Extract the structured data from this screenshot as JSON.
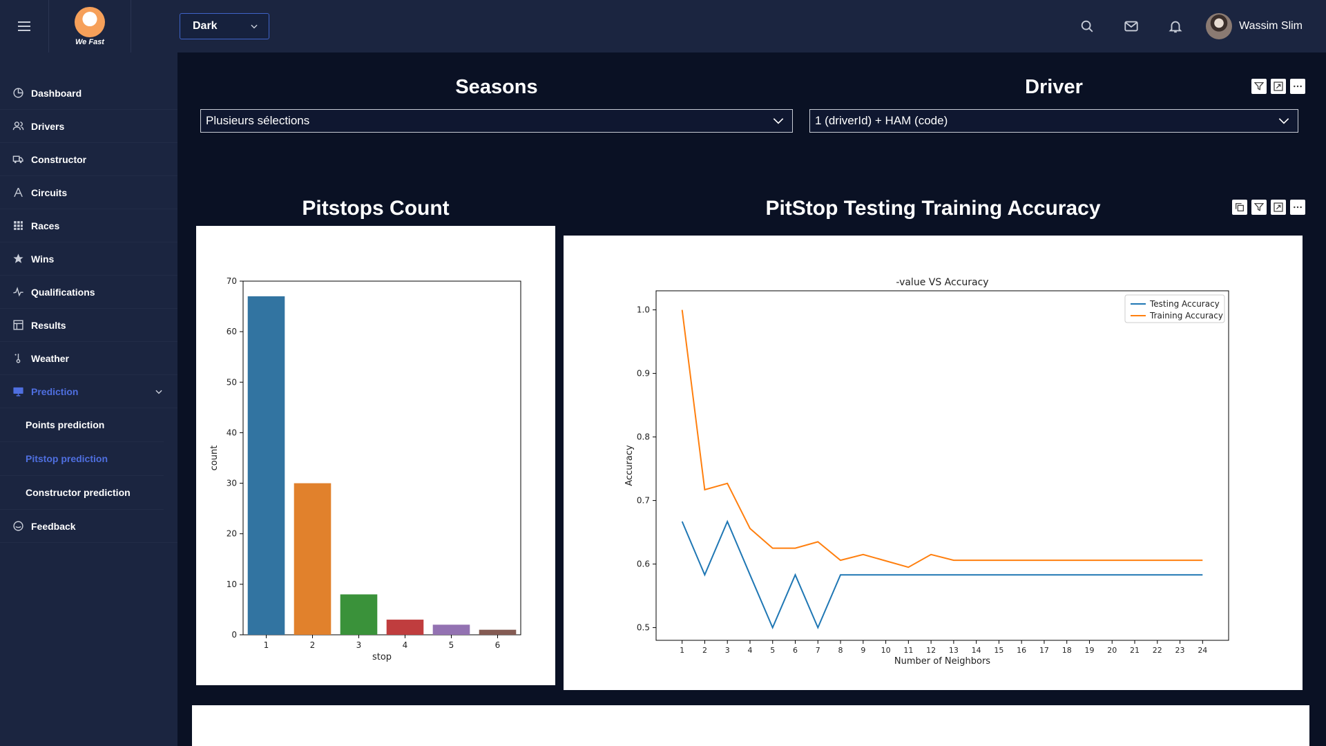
{
  "app": {
    "logo_text": "We Fast",
    "theme_value": "Dark",
    "user_name": "Wassim Slim"
  },
  "sidebar": {
    "items": [
      {
        "label": "Dashboard",
        "icon": "pie-chart-icon"
      },
      {
        "label": "Drivers",
        "icon": "users-icon"
      },
      {
        "label": "Constructor",
        "icon": "truck-icon"
      },
      {
        "label": "Circuits",
        "icon": "circuit-icon"
      },
      {
        "label": "Races",
        "icon": "grid-icon"
      },
      {
        "label": "Wins",
        "icon": "star-icon"
      },
      {
        "label": "Qualifications",
        "icon": "pulse-icon"
      },
      {
        "label": "Results",
        "icon": "table-icon"
      },
      {
        "label": "Weather",
        "icon": "thermometer-icon"
      },
      {
        "label": "Prediction",
        "icon": "monitor-icon"
      }
    ],
    "sub_items": [
      {
        "label": "Points prediction"
      },
      {
        "label": "Pitstop prediction"
      },
      {
        "label": "Constructor prediction"
      }
    ],
    "feedback": {
      "label": "Feedback",
      "icon": "feedback-icon"
    }
  },
  "filters": {
    "seasons": {
      "title": "Seasons",
      "value": "Plusieurs sélections"
    },
    "driver": {
      "title": "Driver",
      "value": "1 (driverId) + HAM (code)"
    }
  },
  "pitstops_chart": {
    "title": "Pitstops Count"
  },
  "accuracy_chart": {
    "title": "PitStop Testing Training Accuracy"
  },
  "colors": {
    "accent": "#4f6fe0",
    "background": "#0a1124",
    "panel": "#1b2540"
  },
  "chart_data": [
    {
      "type": "bar",
      "categories": [
        "1",
        "2",
        "3",
        "4",
        "5",
        "6"
      ],
      "values": [
        67,
        30,
        8,
        3,
        2,
        1
      ],
      "colors": [
        "#3274a1",
        "#e1812c",
        "#3a923a",
        "#c03d3e",
        "#9372b2",
        "#845b53"
      ],
      "title": "",
      "xlabel": "stop",
      "ylabel": "count",
      "ylim": [
        0,
        70
      ],
      "yticks": [
        "0",
        "10",
        "20",
        "30",
        "40",
        "50",
        "60",
        "70"
      ],
      "grid": false
    },
    {
      "type": "line",
      "title": "-value VS Accuracy",
      "xlabel": "Number of Neighbors",
      "ylabel": "Accuracy",
      "x": [
        1,
        2,
        3,
        4,
        5,
        6,
        7,
        8,
        9,
        10,
        11,
        12,
        13,
        14,
        15,
        16,
        17,
        18,
        19,
        20,
        21,
        22,
        23,
        24
      ],
      "xticks": [
        "1",
        "2",
        "3",
        "4",
        "5",
        "6",
        "7",
        "8",
        "9",
        "10",
        "11",
        "12",
        "13",
        "14",
        "15",
        "16",
        "17",
        "18",
        "19",
        "20",
        "21",
        "22",
        "23",
        "24"
      ],
      "ylim": [
        0.48,
        1.03
      ],
      "yticks": [
        "0.5",
        "0.6",
        "0.7",
        "0.8",
        "0.9",
        "1.0"
      ],
      "series": [
        {
          "name": "Testing Accuracy",
          "color": "#1f77b4",
          "values": [
            0.667,
            0.583,
            0.667,
            0.583,
            0.5,
            0.583,
            0.5,
            0.583,
            0.583,
            0.583,
            0.583,
            0.583,
            0.583,
            0.583,
            0.583,
            0.583,
            0.583,
            0.583,
            0.583,
            0.583,
            0.583,
            0.583,
            0.583,
            0.583
          ]
        },
        {
          "name": "Training Accuracy",
          "color": "#ff7f0e",
          "values": [
            1.0,
            0.717,
            0.727,
            0.656,
            0.625,
            0.625,
            0.635,
            0.606,
            0.615,
            0.605,
            0.595,
            0.615,
            0.606,
            0.606,
            0.606,
            0.606,
            0.606,
            0.606,
            0.606,
            0.606,
            0.606,
            0.606,
            0.606,
            0.606
          ]
        }
      ],
      "legend": "top-right",
      "grid": false
    }
  ]
}
